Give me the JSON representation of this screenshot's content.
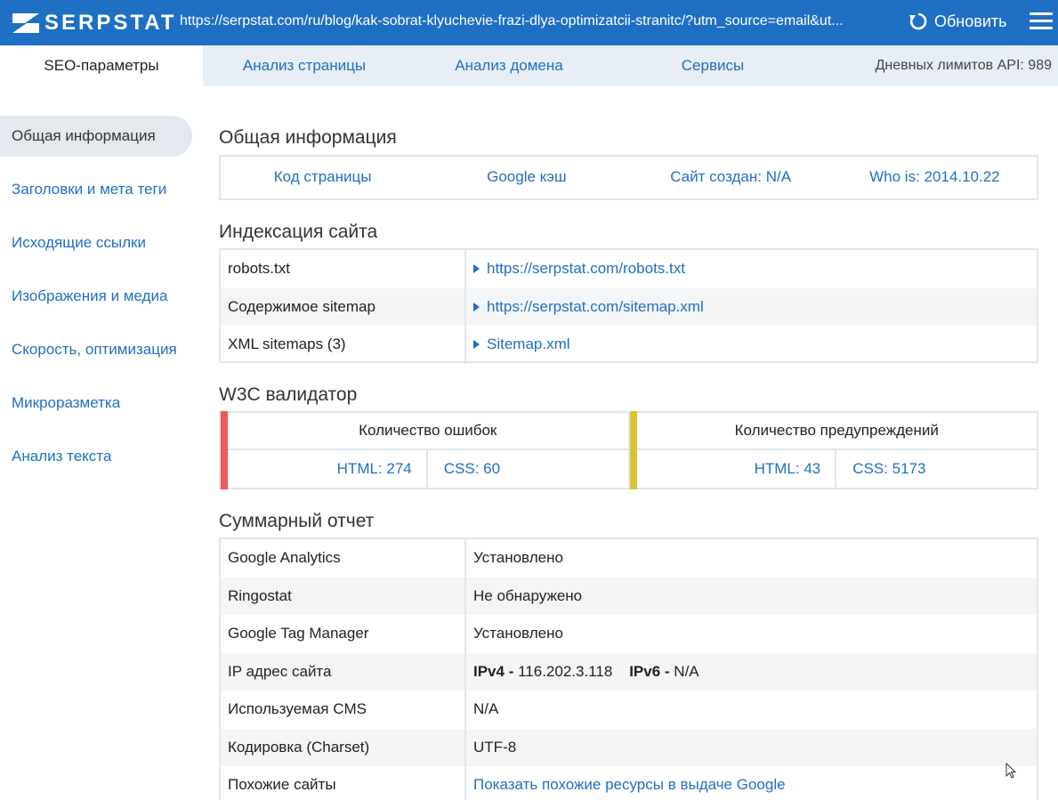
{
  "topbar": {
    "logo_text": "SERPSTAT",
    "url": "https://serpstat.com/ru/blog/kak-sobrat-klyuchevie-frazi-dlya-optimizatcii-stranitc/?utm_source=email&ut...",
    "refresh_label": "Обновить"
  },
  "tabs": [
    {
      "label": "SEO-параметры"
    },
    {
      "label": "Анализ страницы"
    },
    {
      "label": "Анализ домена"
    },
    {
      "label": "Сервисы"
    }
  ],
  "api_limit": "Дневных лимитов API: 989",
  "sidebar": {
    "items": [
      {
        "label": "Общая информация"
      },
      {
        "label": "Заголовки и мета теги"
      },
      {
        "label": "Исходящие ссылки"
      },
      {
        "label": "Изображения и медиа"
      },
      {
        "label": "Скорость, оптимизация"
      },
      {
        "label": "Микроразметка"
      },
      {
        "label": "Анализ текста"
      }
    ]
  },
  "general": {
    "title": "Общая информация",
    "links": [
      {
        "label": "Код страницы"
      },
      {
        "label": "Google кэш"
      },
      {
        "label": "Сайт создан: N/A"
      },
      {
        "label": "Who is: 2014.10.22"
      }
    ]
  },
  "indexing": {
    "title": "Индексация сайта",
    "rows": [
      {
        "key": "robots.txt",
        "value": "https://serpstat.com/robots.txt"
      },
      {
        "key": "Содержимое sitemap",
        "value": "https://serpstat.com/sitemap.xml"
      },
      {
        "key": "XML sitemaps (3)",
        "value": "Sitemap.xml"
      }
    ]
  },
  "w3c": {
    "title": "W3C валидатор",
    "errors": {
      "label": "Количество ошибок",
      "html": "HTML: 274",
      "css": "CSS: 60",
      "color": "#f05a5a"
    },
    "warnings": {
      "label": "Количество предупреждений",
      "html": "HTML: 43",
      "css": "CSS: 5173",
      "color": "#d9c334"
    }
  },
  "summary": {
    "title": "Суммарный отчет",
    "rows": [
      {
        "key": "Google Analytics",
        "value": "Установлено"
      },
      {
        "key": "Ringostat",
        "value": "Не обнаружено"
      },
      {
        "key": "Google Tag Manager",
        "value": "Установлено"
      },
      {
        "key": "IP адрес сайта",
        "ipv4_label": "IPv4 -",
        "ipv4": "116.202.3.118",
        "ipv6_label": "IPv6 -",
        "ipv6": "N/A"
      },
      {
        "key": "Используемая CMS",
        "value": "N/A"
      },
      {
        "key": "Кодировка (Charset)",
        "value": "UTF-8"
      },
      {
        "key": "Похожие сайты",
        "value": "Показать похожие ресурсы в выдаче Google"
      }
    ]
  },
  "colors": {
    "brand": "#1f6fc5",
    "tab_bg": "#e7eef6",
    "border": "#e2e6ea",
    "row_alt": "#f3f5f7"
  }
}
